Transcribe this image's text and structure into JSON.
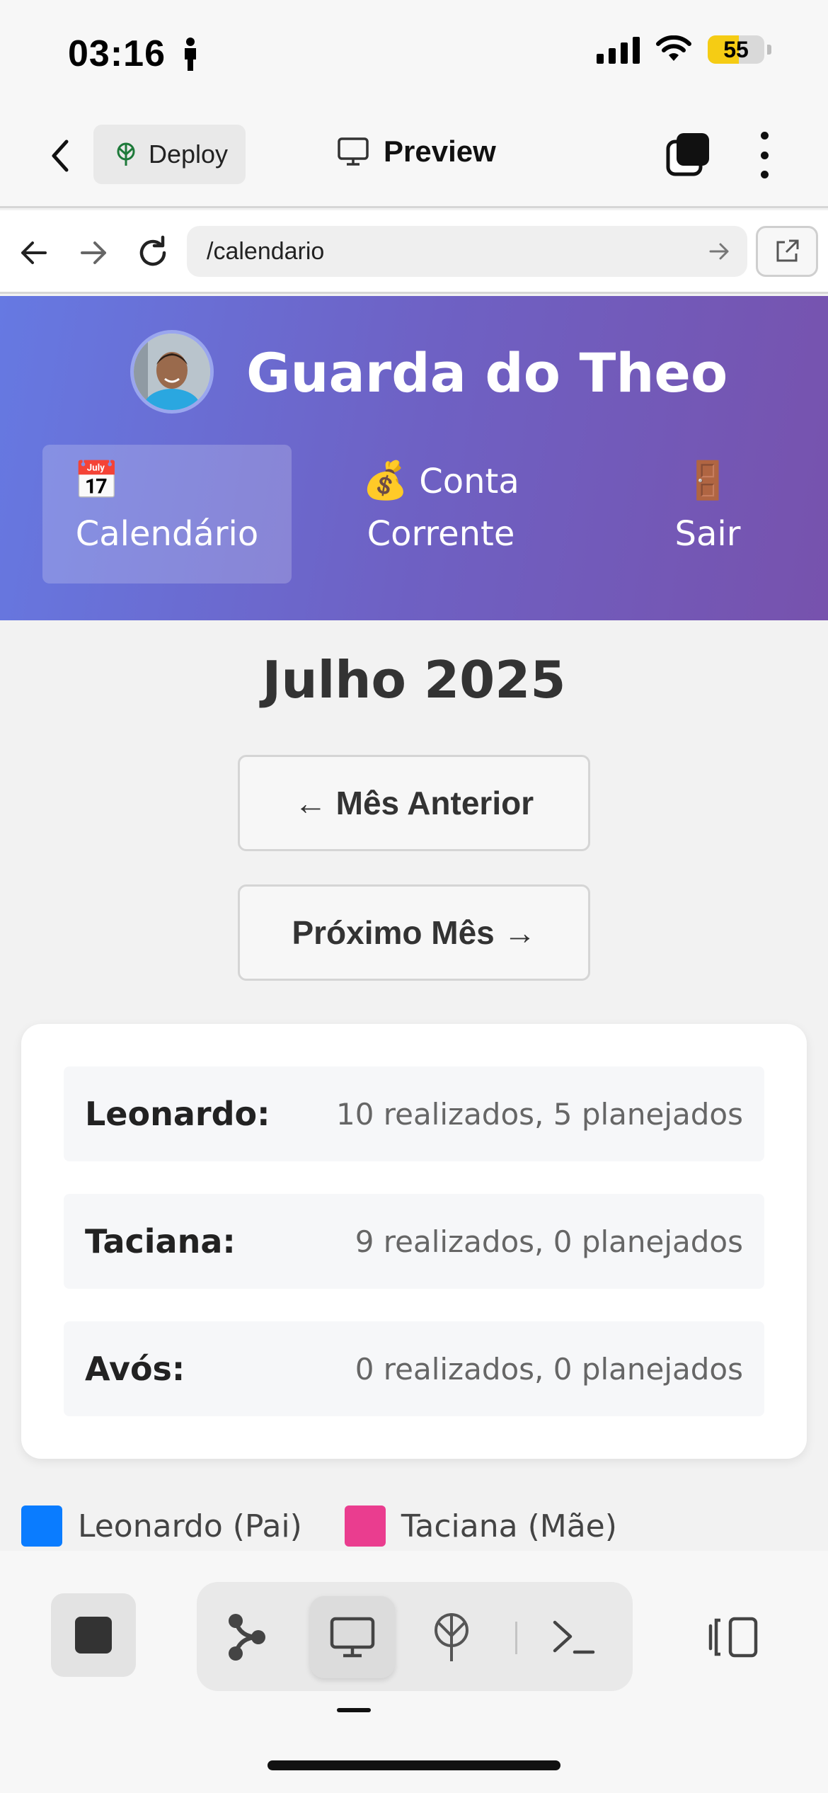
{
  "status_bar": {
    "time": "03:16",
    "battery": "55",
    "battery_level": 0.55
  },
  "toolbar": {
    "deploy_label": "Deploy",
    "preview_label": "Preview"
  },
  "browser": {
    "url": "/calendario"
  },
  "site": {
    "title": "Guarda do Theo",
    "nav": [
      {
        "icon": "📅",
        "label": "Calendário"
      },
      {
        "icon": "💰",
        "label": "Conta Corrente"
      },
      {
        "icon": "🚪",
        "label": "Sair"
      }
    ]
  },
  "calendar": {
    "month_title": "Julho 2025",
    "prev_label": "← Mês Anterior",
    "next_label": "Próximo Mês →"
  },
  "stats": [
    {
      "name": "Leonardo:",
      "value": "10 realizados, 5 planejados"
    },
    {
      "name": "Taciana:",
      "value": "9 realizados, 0 planejados"
    },
    {
      "name": "Avós:",
      "value": "0 realizados, 0 planejados"
    }
  ],
  "legend": [
    {
      "label": "Leonardo (Pai)",
      "color": "#0a7cff"
    },
    {
      "label": "Taciana (Mãe)",
      "color": "#ea3d8f"
    }
  ],
  "colors": {
    "header_start": "#6679e2",
    "header_end": "#7752ad"
  }
}
